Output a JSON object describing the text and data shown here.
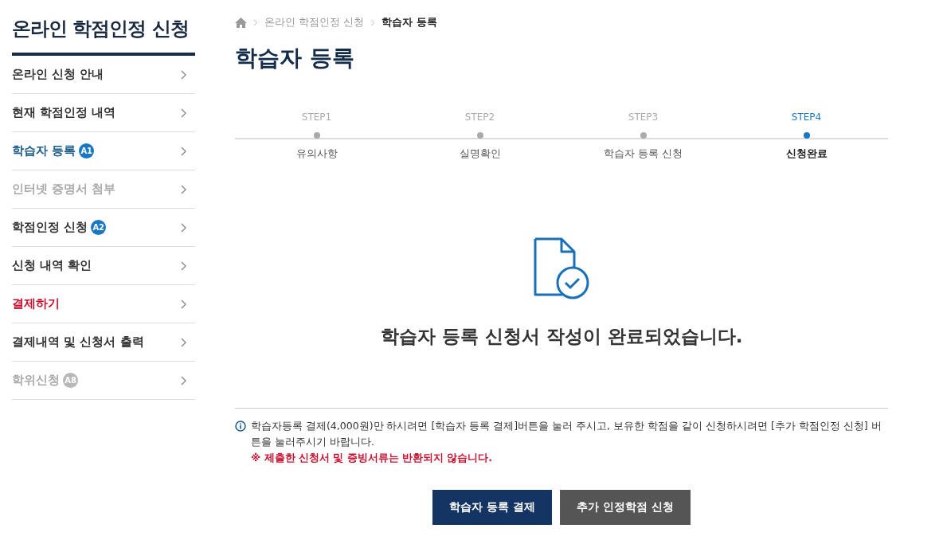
{
  "sidebar": {
    "title": "온라인 학점인정 신청",
    "items": [
      {
        "label": "온라인 신청 안내",
        "selected": false,
        "disabled": false,
        "highlighted": false
      },
      {
        "label": "현재 학점인정 내역",
        "selected": false,
        "disabled": false,
        "highlighted": false
      },
      {
        "label": "학습자 등록",
        "selected": true,
        "disabled": false,
        "highlighted": false,
        "badge": "A1"
      },
      {
        "label": "인터넷 증명서 첨부",
        "selected": false,
        "disabled": true,
        "highlighted": false
      },
      {
        "label": "학점인정 신청",
        "selected": false,
        "disabled": false,
        "highlighted": false,
        "badge": "A2"
      },
      {
        "label": "신청 내역 확인",
        "selected": false,
        "disabled": false,
        "highlighted": false
      },
      {
        "label": "결제하기",
        "selected": false,
        "disabled": false,
        "highlighted": true
      },
      {
        "label": "결제내역 및 신청서 출력",
        "selected": false,
        "disabled": false,
        "highlighted": false
      },
      {
        "label": "학위신청",
        "selected": false,
        "disabled": true,
        "highlighted": false,
        "badge": "A8"
      }
    ]
  },
  "breadcrumb": [
    "온라인 학점인정 신청",
    "학습자 등록"
  ],
  "page_title": "학습자 등록",
  "steps": [
    {
      "step": "STEP1",
      "label": "유의사항",
      "selected": false
    },
    {
      "step": "STEP2",
      "label": "실명확인",
      "selected": false
    },
    {
      "step": "STEP3",
      "label": "학습자 등록 신청",
      "selected": false
    },
    {
      "step": "STEP4",
      "label": "신청완료",
      "selected": true
    }
  ],
  "message": "학습자 등록 신청서 작성이 완료되었습니다.",
  "notice": {
    "text": "학습자등록 결제(4,000원)만 하시려면 [학습자 등록 결제]버튼을 눌러 주시고, 보유한 학점을 같이 신청하시려면 [추가 학점인정 신청] 버튼을 눌러주시기 바랍니다.",
    "warning": "※ 제출한 신청서 및 증빙서류는 반환되지 않습니다."
  },
  "buttons": [
    {
      "label": "학습자 등록 결제",
      "kind": "primary"
    },
    {
      "label": "추가 인정학점 신청",
      "kind": "secondary"
    }
  ]
}
